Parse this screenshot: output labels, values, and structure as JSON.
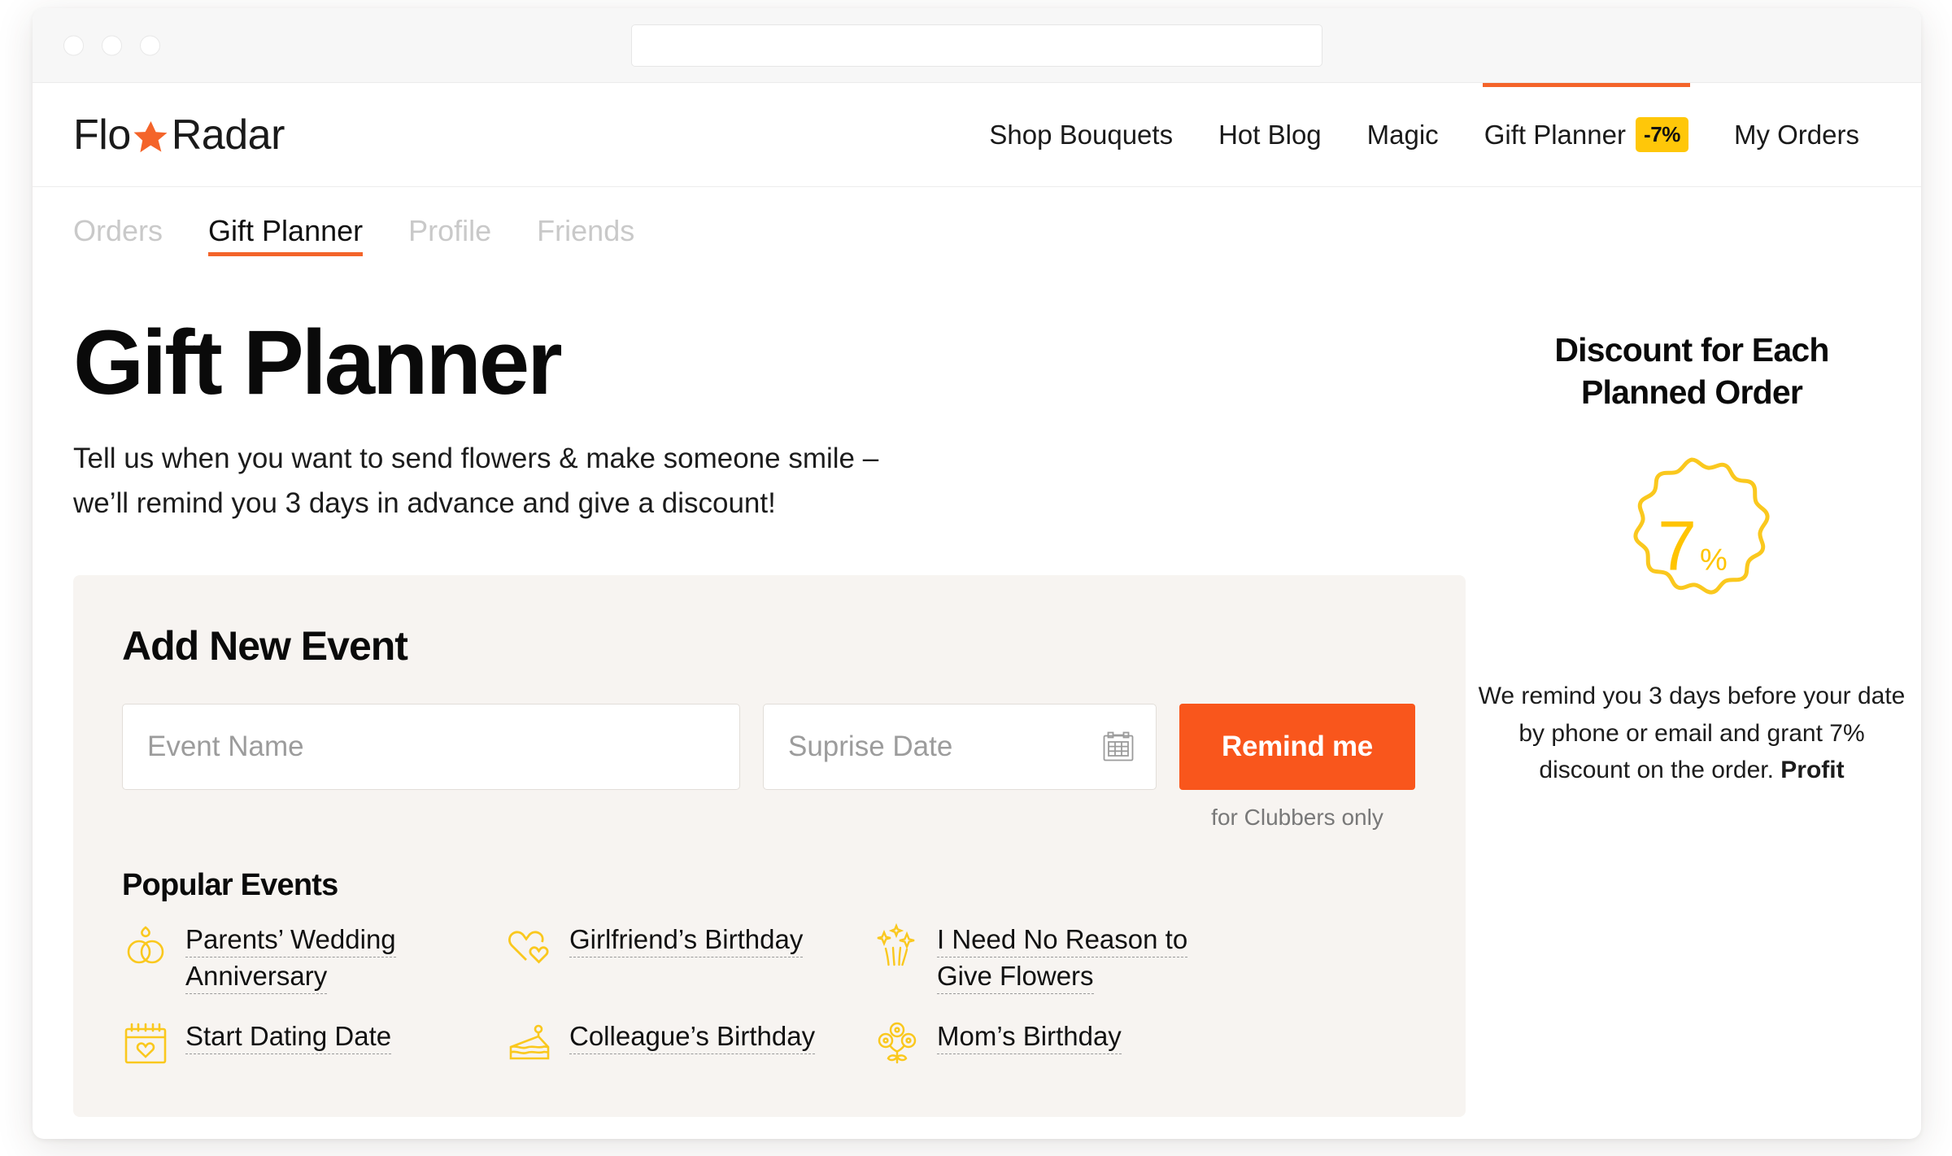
{
  "browser": {
    "traffic_lights": [
      "close",
      "minimize",
      "maximize"
    ],
    "url_value": "",
    "url_placeholder": ""
  },
  "header": {
    "logo": {
      "text_before": "Flo",
      "text_after": "Radar",
      "icon": "star-icon",
      "star_color": "#f4642a"
    },
    "nav": [
      {
        "label": "Shop Bouquets",
        "active": false,
        "badge": null
      },
      {
        "label": "Hot Blog",
        "active": false,
        "badge": null
      },
      {
        "label": "Magic",
        "active": false,
        "badge": null
      },
      {
        "label": "Gift Planner",
        "active": true,
        "badge": "-7%"
      },
      {
        "label": "My Orders",
        "active": false,
        "badge": null
      }
    ]
  },
  "sub_nav": {
    "tabs": [
      {
        "label": "Orders",
        "active": false
      },
      {
        "label": "Gift Planner",
        "active": true
      },
      {
        "label": "Profile",
        "active": false
      },
      {
        "label": "Friends",
        "active": false
      }
    ]
  },
  "main": {
    "title": "Gift Planner",
    "subtitle_line1": "Tell us when you want to send flowers & make someone smile –",
    "subtitle_line2": "we’ll remind you 3 days in advance and give a discount!",
    "card": {
      "title": "Add New Event",
      "event_name_value": "",
      "event_name_placeholder": "Event Name",
      "date_value": "",
      "date_placeholder": "Suprise Date",
      "calendar_icon": "calendar-icon",
      "submit_label": "Remind me",
      "submit_note": "for Clubbers only",
      "popular_title": "Popular Events",
      "popular_events": [
        {
          "label": "Parents’ Wedding Anniversary",
          "icon": "wedding-rings-icon"
        },
        {
          "label": "Girlfriend’s Birthday",
          "icon": "two-hearts-icon"
        },
        {
          "label": "I Need No Reason to Give Flowers",
          "icon": "sparkles-icon"
        },
        {
          "label": "Start Dating Date",
          "icon": "calendar-heart-icon"
        },
        {
          "label": "Colleague’s Birthday",
          "icon": "cake-slice-icon"
        },
        {
          "label": "Mom’s Birthday",
          "icon": "flower-bouquet-icon"
        }
      ]
    }
  },
  "sidebar": {
    "title_line1": "Discount for Each",
    "title_line2": "Planned Order",
    "badge_value": "7",
    "badge_unit": "%",
    "description_text": "We remind you 3 days before your date by phone or email and grant 7% discount on the order. ",
    "description_bold": "Profit"
  },
  "colors": {
    "accent_orange": "#f4642a",
    "button_orange": "#f9561c",
    "badge_yellow": "#ffc709",
    "icon_yellow": "#ffc400",
    "card_bg": "#f7f4f1",
    "text_dark": "#111111",
    "text_muted": "#c9c9c9"
  }
}
